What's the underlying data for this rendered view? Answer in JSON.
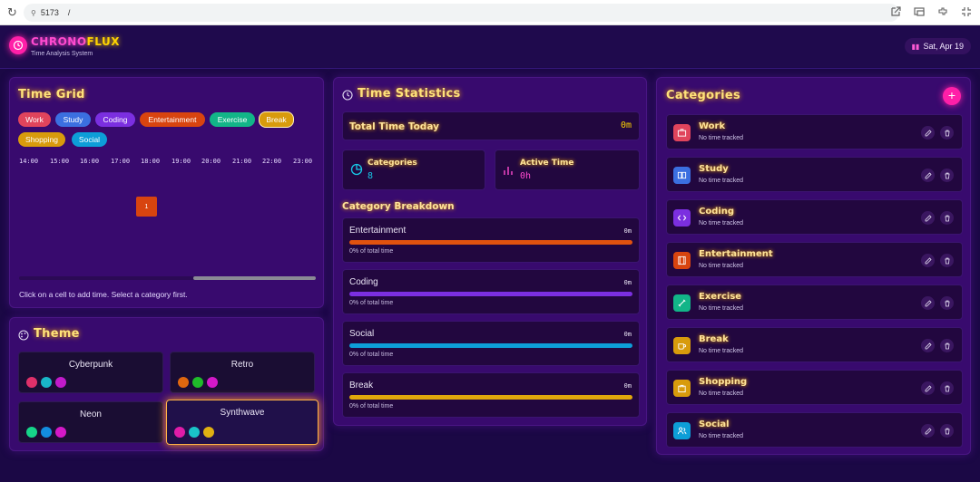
{
  "browser": {
    "url_host": "5173",
    "url_path": "/"
  },
  "header": {
    "title_part1": "CHRONO",
    "title_part2": "FLUX",
    "subtitle": "Time Analysis System",
    "date": "Sat, Apr 19"
  },
  "time_grid": {
    "title": "Time Grid",
    "chips": [
      {
        "label": "Work",
        "color": "#e0445c"
      },
      {
        "label": "Study",
        "color": "#3b6fe0"
      },
      {
        "label": "Coding",
        "color": "#7b2fe0"
      },
      {
        "label": "Entertainment",
        "color": "#d8440f"
      },
      {
        "label": "Exercise",
        "color": "#12b588"
      },
      {
        "label": "Break",
        "color": "#d89b0c"
      },
      {
        "label": "Shopping",
        "color": "#d89b0c"
      },
      {
        "label": "Social",
        "color": "#0d9ed8"
      }
    ],
    "hours": [
      "14:00",
      "15:00",
      "16:00",
      "17:00",
      "18:00",
      "19:00",
      "20:00",
      "21:00",
      "22:00",
      "23:00"
    ],
    "cell_value": "1",
    "hint": "Click on a cell to add time. Select a category first."
  },
  "theme": {
    "title": "Theme",
    "options": [
      {
        "name": "Cyberpunk",
        "colors": [
          "#e0306a",
          "#19b6c8",
          "#c21acb"
        ]
      },
      {
        "name": "Retro",
        "colors": [
          "#e0670f",
          "#1fbb2a",
          "#d418c8"
        ]
      },
      {
        "name": "Neon",
        "colors": [
          "#16d48a",
          "#138de0",
          "#d418c8"
        ]
      },
      {
        "name": "Synthwave",
        "colors": [
          "#e01ca8",
          "#1ac3c8",
          "#e0b011"
        ]
      }
    ],
    "selected": "Synthwave"
  },
  "stats": {
    "title": "Time Statistics",
    "total_label": "Total Time Today",
    "total_value": "0m",
    "categories_label": "Categories",
    "categories_value": "8",
    "active_label": "Active Time",
    "active_value": "0h",
    "breakdown_title": "Category Breakdown",
    "breakdown": [
      {
        "name": "Entertainment",
        "value": "0m",
        "pct": "0% of total time",
        "color": "#e0520f"
      },
      {
        "name": "Coding",
        "value": "0m",
        "pct": "0% of total time",
        "color": "#7b2fe0"
      },
      {
        "name": "Social",
        "value": "0m",
        "pct": "0% of total time",
        "color": "#0d9ed8"
      },
      {
        "name": "Break",
        "value": "0m",
        "pct": "0% of total time",
        "color": "#e0a80c"
      }
    ]
  },
  "categories": {
    "title": "Categories",
    "items": [
      {
        "name": "Work",
        "sub": "No time tracked",
        "color": "#e0445c",
        "icon": "briefcase-icon"
      },
      {
        "name": "Study",
        "sub": "No time tracked",
        "color": "#3b6fe0",
        "icon": "book-icon"
      },
      {
        "name": "Coding",
        "sub": "No time tracked",
        "color": "#7b2fe0",
        "icon": "code-icon"
      },
      {
        "name": "Entertainment",
        "sub": "No time tracked",
        "color": "#d8440f",
        "icon": "film-icon"
      },
      {
        "name": "Exercise",
        "sub": "No time tracked",
        "color": "#12b588",
        "icon": "dumbbell-icon"
      },
      {
        "name": "Break",
        "sub": "No time tracked",
        "color": "#d89b0c",
        "icon": "coffee-icon"
      },
      {
        "name": "Shopping",
        "sub": "No time tracked",
        "color": "#d89b0c",
        "icon": "shopping-bag-icon"
      },
      {
        "name": "Social",
        "sub": "No time tracked",
        "color": "#0d9ed8",
        "icon": "users-icon"
      }
    ]
  }
}
